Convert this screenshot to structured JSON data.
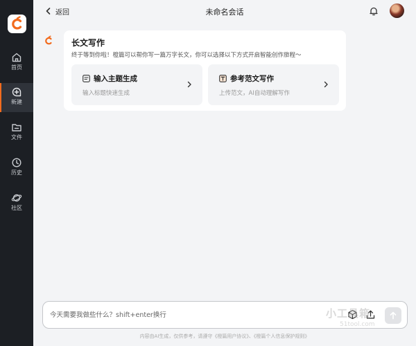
{
  "sidebar": {
    "logo_icon": "brand-logo-c",
    "items": [
      {
        "label": "首页",
        "icon": "home-icon"
      },
      {
        "label": "新建",
        "icon": "new-chat-icon",
        "active": true
      },
      {
        "label": "文件",
        "icon": "folder-icon"
      },
      {
        "label": "历史",
        "icon": "clock-icon"
      },
      {
        "label": "社区",
        "icon": "planet-icon"
      }
    ]
  },
  "header": {
    "back_label": "返回",
    "title": "未命名会话"
  },
  "welcome": {
    "title": "长文写作",
    "subtitle": "终于等到你啦！橙篇可以帮你写一篇万字长文，你可以选择以下方式开启智能创作旅程～",
    "options": [
      {
        "title": "输入主题生成",
        "description": "输入标题快速生成",
        "icon": "document-icon"
      },
      {
        "title": "参考范文写作",
        "description": "上传范文，AI自动理解写作",
        "icon": "template-t-icon"
      }
    ]
  },
  "composer": {
    "placeholder": "今天需要我做些什么？shift+enter换行"
  },
  "footer": {
    "note": "内容由AI生成，仅供参考，请遵守《橙篇用户协议》、《橙篇个人信息保护规则》"
  },
  "watermark": {
    "text": "小工具箱",
    "sub": "51tool.com"
  },
  "colors": {
    "accent": "#f26b1d",
    "sidebar_bg": "#1c1f24",
    "page_bg": "#f3f4f6"
  }
}
